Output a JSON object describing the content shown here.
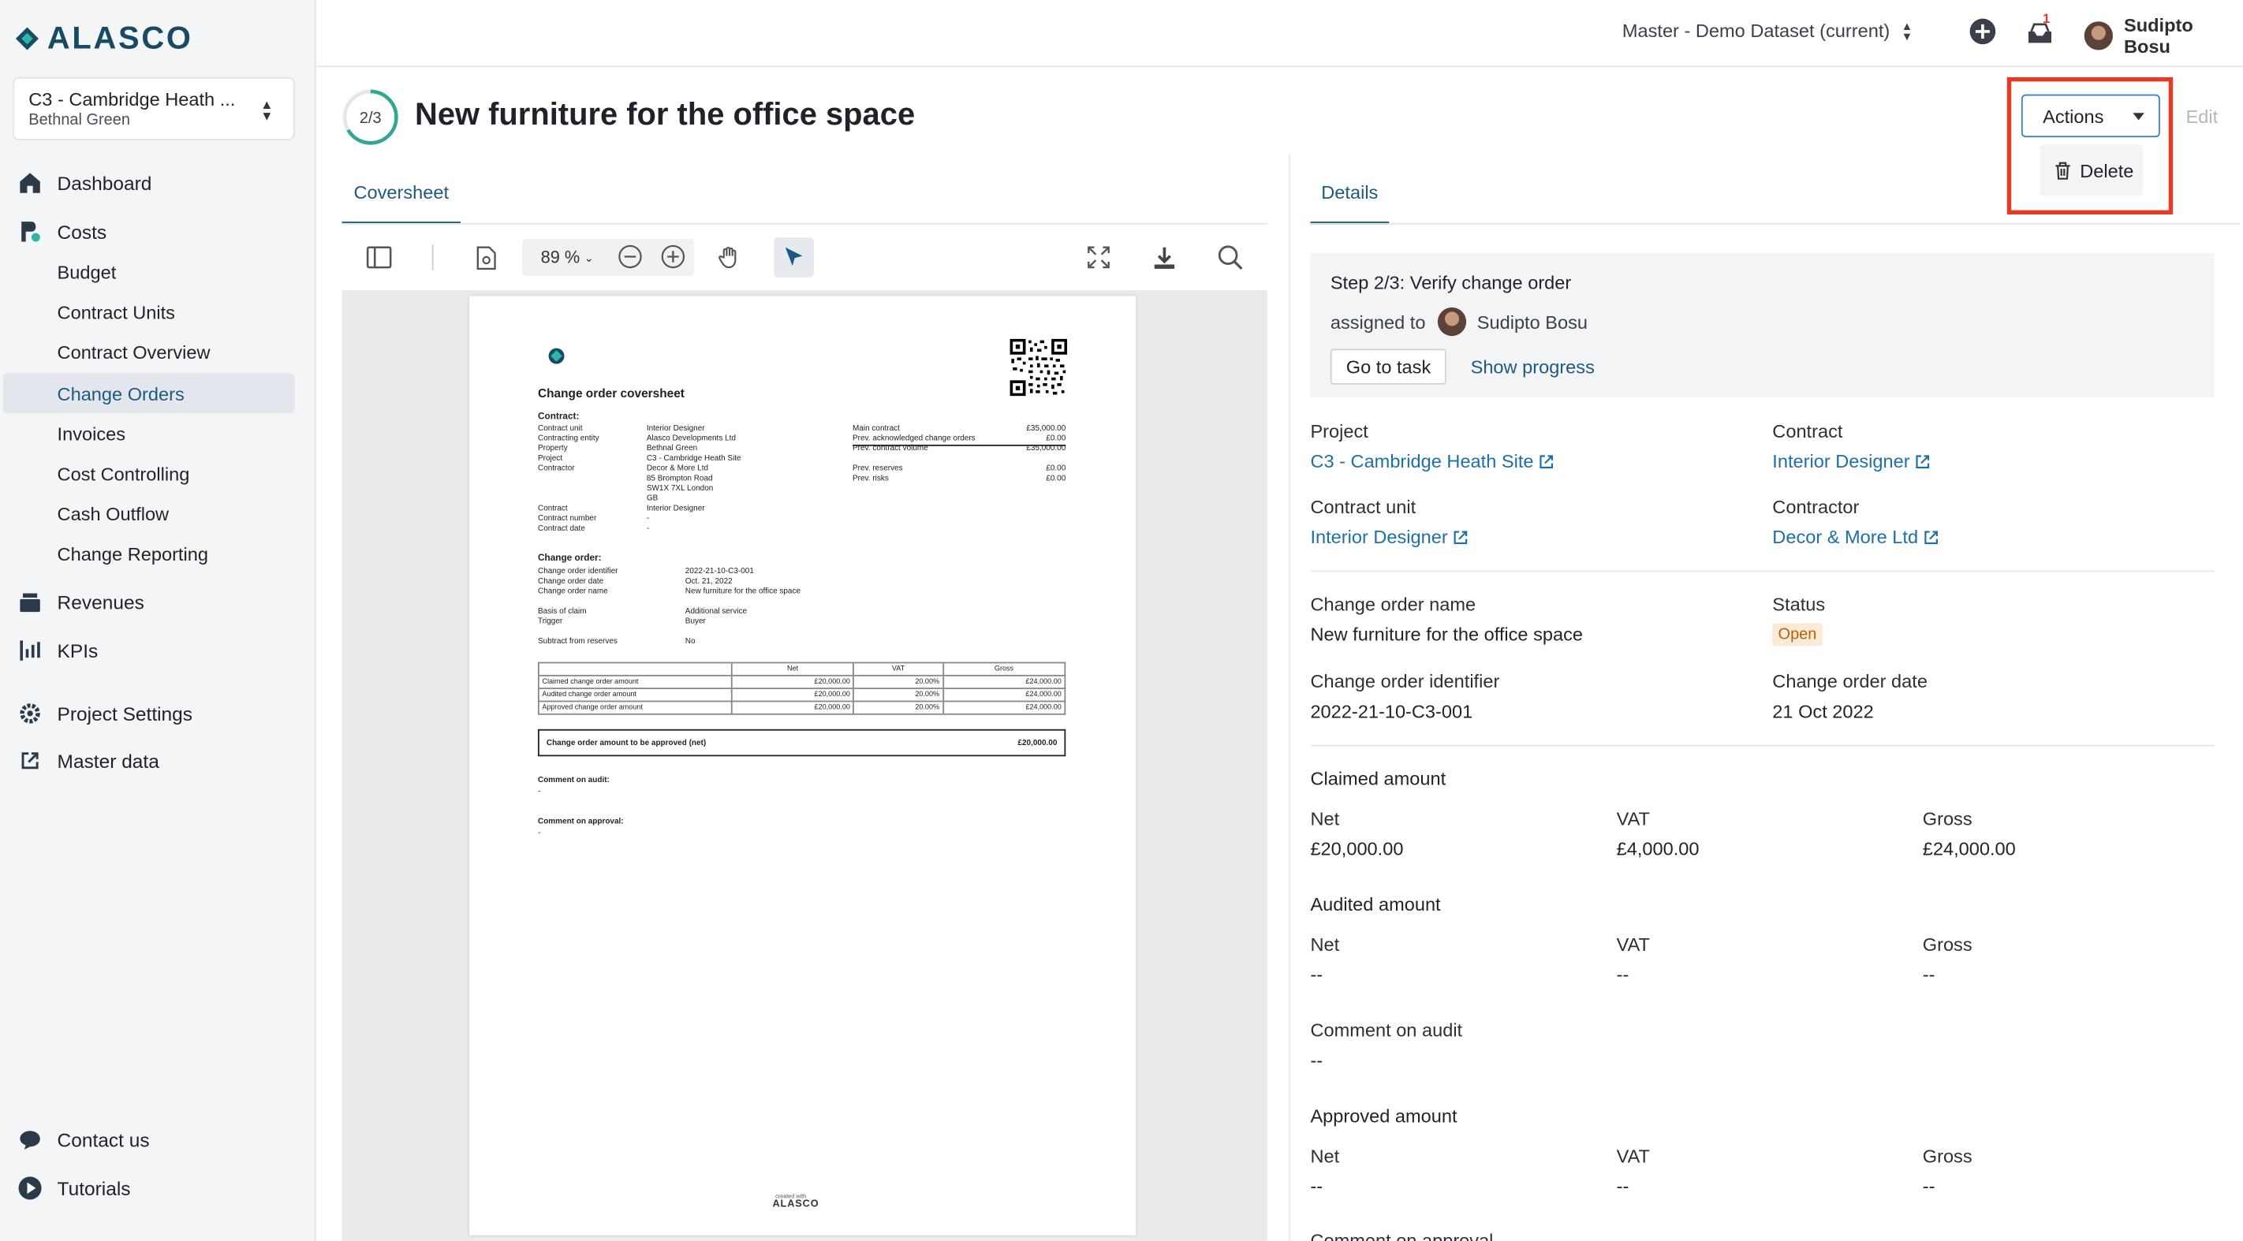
{
  "brand": {
    "name": "ALASCO"
  },
  "project": {
    "title": "C3 - Cambridge Heath ...",
    "subtitle": "Bethnal Green"
  },
  "nav": {
    "dashboard": "Dashboard",
    "costs": "Costs",
    "budget": "Budget",
    "contract_units": "Contract Units",
    "contract_overview": "Contract Overview",
    "change_orders": "Change Orders",
    "invoices": "Invoices",
    "cost_controlling": "Cost Controlling",
    "cash_outflow": "Cash Outflow",
    "change_reporting": "Change Reporting",
    "revenues": "Revenues",
    "kpis": "KPIs",
    "project_settings": "Project Settings",
    "master_data": "Master data",
    "contact_us": "Contact us",
    "tutorials": "Tutorials"
  },
  "topbar": {
    "dataset": "Master - Demo Dataset (current)",
    "notification_count": "1",
    "user": "Sudipto Bosu"
  },
  "header": {
    "progress": "2/3",
    "progress_fraction": 0.667,
    "title": "New furniture for the office space",
    "actions": "Actions",
    "edit": "Edit",
    "delete": "Delete"
  },
  "viewer": {
    "tab": "Coversheet",
    "zoom": "89 %"
  },
  "doc": {
    "title": "Change order coversheet",
    "contract_head": "Contract:",
    "contract_labels": [
      "Contract unit",
      "Contracting entity",
      "Property",
      "Project",
      "Contractor",
      "",
      "",
      "",
      "Contract",
      "Contract number",
      "Contract date"
    ],
    "contract_values": [
      "Interior Designer",
      "Alasco Developments Ltd",
      "Bethnal Green",
      "C3 - Cambridge Heath Site",
      "Decor & More Ltd",
      "85 Brompton Road",
      "SW1X 7XL London",
      "GB",
      "Interior Designer",
      "-",
      "-"
    ],
    "summary_labels": [
      "Main contract",
      "Prev. acknowledged change orders",
      "Prev. contract volume",
      "",
      "Prev. reserves",
      "Prev. risks"
    ],
    "summary_values": [
      "£35,000.00",
      "£0.00",
      "£35,000.00",
      "",
      "£0.00",
      "£0.00"
    ],
    "change_head": "Change order:",
    "change_labels": [
      "Change order identifier",
      "Change order date",
      "Change order name",
      "",
      "Basis of claim",
      "Trigger",
      "",
      "Subtract from reserves"
    ],
    "change_values": [
      "2022-21-10-C3-001",
      "Oct. 21, 2022",
      "New furniture for the office space",
      "",
      "Additional service",
      "Buyer",
      "",
      "No"
    ],
    "table_head": [
      "",
      "Net",
      "VAT",
      "",
      "Gross"
    ],
    "table_rows": [
      [
        "Claimed change order amount",
        "£20,000.00",
        "20.00%",
        "£24,000.00"
      ],
      [
        "Audited change order amount",
        "£20,000.00",
        "20.00%",
        "£24,000.00"
      ],
      [
        "Approved change order amount",
        "£20,000.00",
        "20.00%",
        "£24,000.00"
      ]
    ],
    "approve_label": "Change order amount to be approved (net)",
    "approve_value": "£20,000.00",
    "comment_audit": "Comment on audit:",
    "comment_approval": "Comment on approval:",
    "dash": "-",
    "footer_small": "created with",
    "footer_brand": "ALASCO"
  },
  "details": {
    "tab": "Details",
    "step": "Step 2/3: Verify change order",
    "assigned_to": "assigned to",
    "assignee": "Sudipto Bosu",
    "go_to_task": "Go to task",
    "show_progress": "Show progress",
    "project_label": "Project",
    "project_value": "C3 - Cambridge Heath Site",
    "contract_label": "Contract",
    "contract_value": "Interior Designer",
    "contract_unit_label": "Contract unit",
    "contract_unit_value": "Interior Designer",
    "contractor_label": "Contractor",
    "contractor_value": "Decor & More Ltd",
    "name_label": "Change order name",
    "name_value": "New furniture for the office space",
    "status_label": "Status",
    "status_value": "Open",
    "identifier_label": "Change order identifier",
    "identifier_value": "2022-21-10-C3-001",
    "date_label": "Change order date",
    "date_value": "21 Oct 2022",
    "claimed_title": "Claimed amount",
    "net": "Net",
    "vat": "VAT",
    "gross": "Gross",
    "claimed_net": "£20,000.00",
    "claimed_vat": "£4,000.00",
    "claimed_gross": "£24,000.00",
    "audited_title": "Audited amount",
    "audited_net": "--",
    "audited_vat": "--",
    "audited_gross": "--",
    "comment_audit_label": "Comment on audit",
    "comment_audit_value": "--",
    "approved_title": "Approved amount",
    "approved_net": "--",
    "approved_vat": "--",
    "approved_gross": "--",
    "comment_approval_label": "Comment on approval"
  },
  "colors": {
    "accent": "#1d5a80",
    "link": "#1d6fa8",
    "highlight": "#e53a24",
    "status_bg": "#fbead6",
    "status_text": "#b6620c"
  }
}
